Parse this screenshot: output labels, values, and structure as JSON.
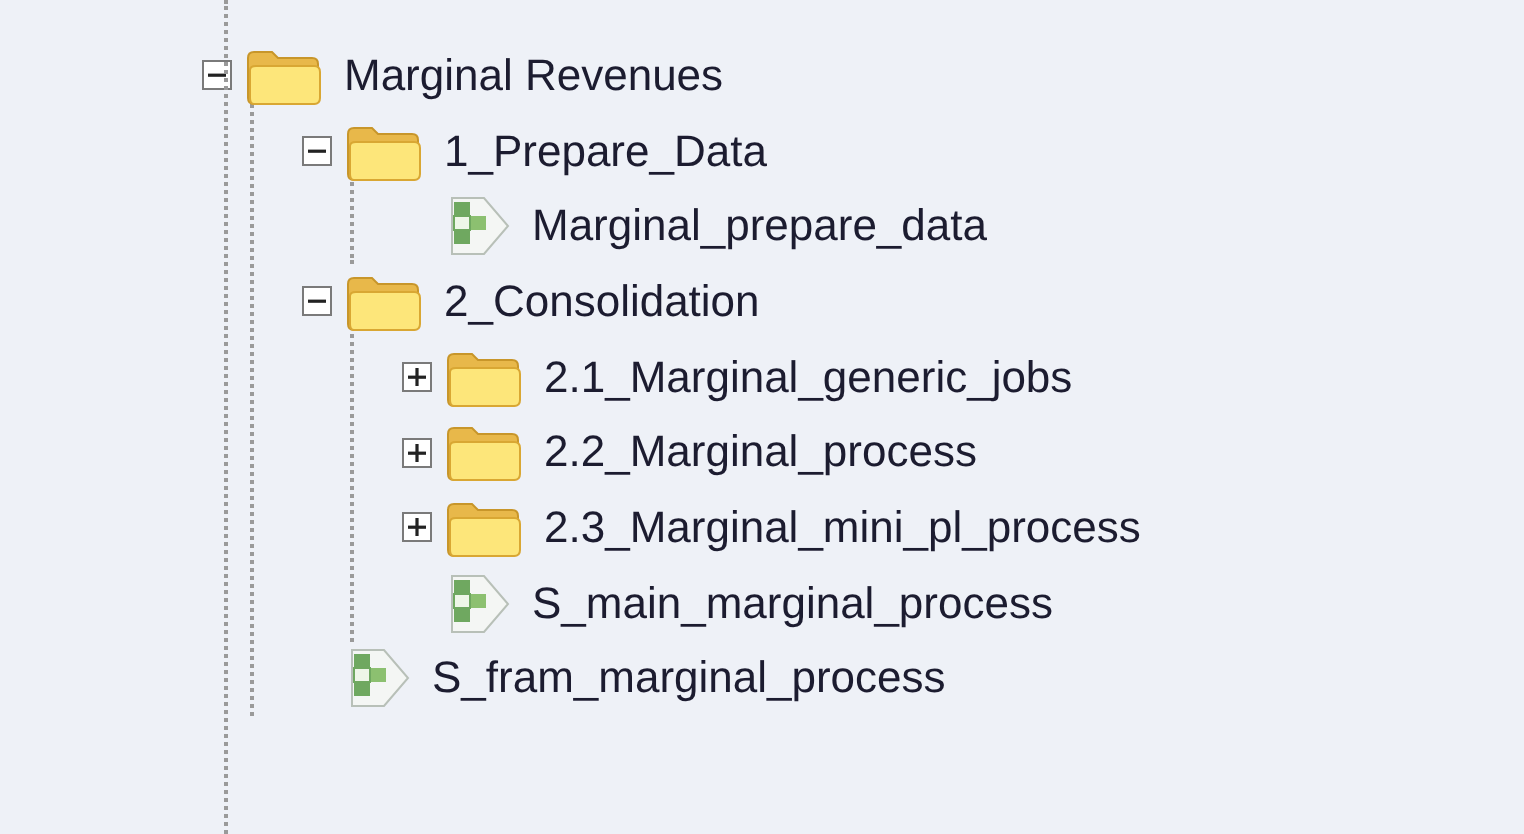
{
  "tree": [
    {
      "kind": "folder",
      "label": "Marginal Revenues",
      "expanded": true,
      "children": [
        {
          "kind": "folder",
          "label": "1_Prepare_Data",
          "expanded": true,
          "children": [
            {
              "kind": "job",
              "label": "Marginal_prepare_data"
            }
          ]
        },
        {
          "kind": "folder",
          "label": "2_Consolidation",
          "expanded": true,
          "children": [
            {
              "kind": "folder",
              "label": "2.1_Marginal_generic_jobs",
              "expanded": false
            },
            {
              "kind": "folder",
              "label": "2.2_Marginal_process",
              "expanded": false
            },
            {
              "kind": "folder",
              "label": "2.3_Marginal_mini_pl_process",
              "expanded": false
            },
            {
              "kind": "job",
              "label": "S_main_marginal_process"
            }
          ]
        },
        {
          "kind": "job",
          "label": "S_fram_marginal_process"
        }
      ]
    }
  ]
}
